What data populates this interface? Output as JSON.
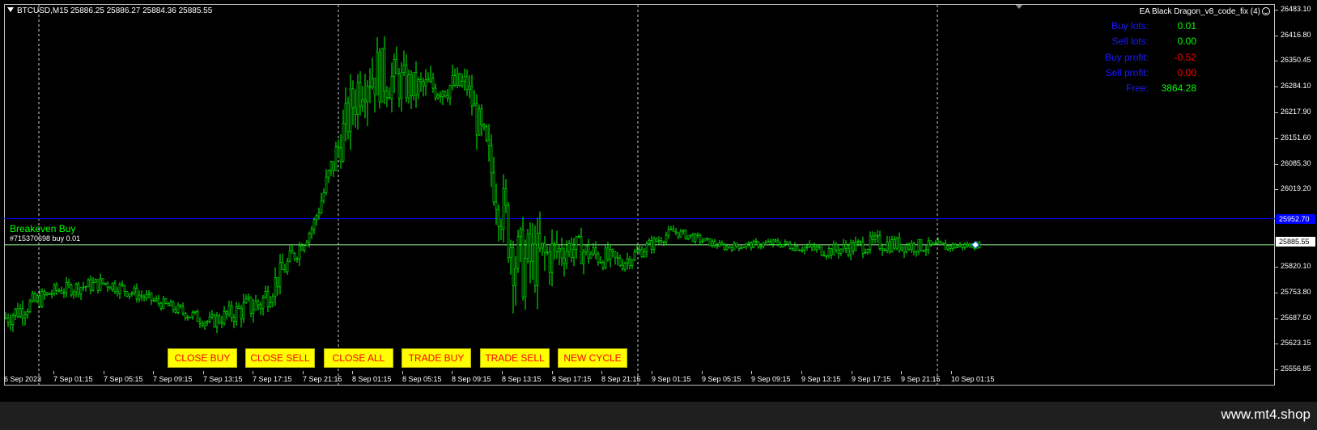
{
  "header": {
    "symbol_line": "BTCUSD,M15  25886.25 25886.27 25884.36 25885.55",
    "ea_title": "EA Black Dragon_v8_code_fix (4)"
  },
  "info_panel": [
    {
      "label": "Buy lots:",
      "value": "0.01",
      "color": "#00ff00"
    },
    {
      "label": "Sell lots:",
      "value": "0.00",
      "color": "#00ff00"
    },
    {
      "label": "Buy profit:",
      "value": "-0.52",
      "color": "#ff0000"
    },
    {
      "label": "Sell profit:",
      "value": "0.00",
      "color": "#ff0000"
    },
    {
      "label": "Free:",
      "value": "3864.28",
      "color": "#00ff00"
    }
  ],
  "lines": {
    "breakeven_label": "Breakeven Buy",
    "order_label": "#715370698 buy 0.01",
    "breakeven_price": 25951.7,
    "current_price": 25885.55
  },
  "price_axis": {
    "ticks": [
      "26483.10",
      "26416.80",
      "26350.45",
      "26284.10",
      "26217.90",
      "26151.60",
      "26085.30",
      "26019.20",
      "25952.70",
      "25885.55",
      "25820.10",
      "25753.80",
      "25687.50",
      "25623.15",
      "25556.85"
    ],
    "current_tag": "25885.55",
    "breakeven_tag": "25952.70"
  },
  "time_axis": [
    "6 Sep 2023",
    "7 Sep 01:15",
    "7 Sep 05:15",
    "7 Sep 09:15",
    "7 Sep 13:15",
    "7 Sep 17:15",
    "7 Sep 21:15",
    "8 Sep 01:15",
    "8 Sep 05:15",
    "8 Sep 09:15",
    "8 Sep 13:15",
    "8 Sep 17:15",
    "8 Sep 21:15",
    "9 Sep 01:15",
    "9 Sep 05:15",
    "9 Sep 09:15",
    "9 Sep 13:15",
    "9 Sep 17:15",
    "9 Sep 21:15",
    "10 Sep 01:15"
  ],
  "buttons": [
    "CLOSE BUY",
    "CLOSE SELL",
    "CLOSE ALL",
    "TRADE BUY",
    "TRADE SELL",
    "NEW CYCLE"
  ],
  "watermark": "www.mt4.shop",
  "colors": {
    "candle": "#00ff00",
    "breakeven_line": "#0000ff",
    "order_line": "#90ee90",
    "button_bg": "#ffff00",
    "button_text": "#ff0000",
    "label_text": "#1a1aff"
  },
  "chart_data": {
    "type": "candlestick",
    "symbol": "BTCUSD",
    "timeframe": "M15",
    "ylim": [
      25556.85,
      26483.1
    ],
    "x": [
      "6 Sep 2023",
      "7 Sep 01:15",
      "7 Sep 05:15",
      "7 Sep 09:15",
      "7 Sep 13:15",
      "7 Sep 17:15",
      "7 Sep 21:15",
      "8 Sep 01:15",
      "8 Sep 05:15",
      "8 Sep 09:15",
      "8 Sep 13:15",
      "8 Sep 17:15",
      "8 Sep 21:15",
      "9 Sep 01:15",
      "9 Sep 05:15",
      "9 Sep 09:15",
      "9 Sep 13:15",
      "9 Sep 17:15",
      "9 Sep 21:15",
      "10 Sep 01:15"
    ],
    "close": [
      25700,
      25770,
      25790,
      25740,
      25690,
      25740,
      25930,
      26330,
      26280,
      26290,
      25830,
      25880,
      25840,
      25920,
      25880,
      25890,
      25870,
      25890,
      25880,
      25885
    ],
    "high": [
      25760,
      25800,
      25850,
      25790,
      25740,
      25840,
      25970,
      26460,
      26440,
      26350,
      26200,
      25950,
      25890,
      25940,
      25910,
      25910,
      25900,
      25960,
      25930,
      25910
    ],
    "low": [
      25580,
      25700,
      25740,
      25710,
      25640,
      25620,
      25860,
      25980,
      26200,
      26150,
      25630,
      25730,
      25760,
      25870,
      25860,
      25850,
      25810,
      25830,
      25840,
      25870
    ],
    "horizontal_lines": [
      {
        "label": "Breakeven Buy",
        "price": 25951.7
      },
      {
        "label": "#715370698 buy 0.01",
        "price": 25885.55
      }
    ]
  }
}
